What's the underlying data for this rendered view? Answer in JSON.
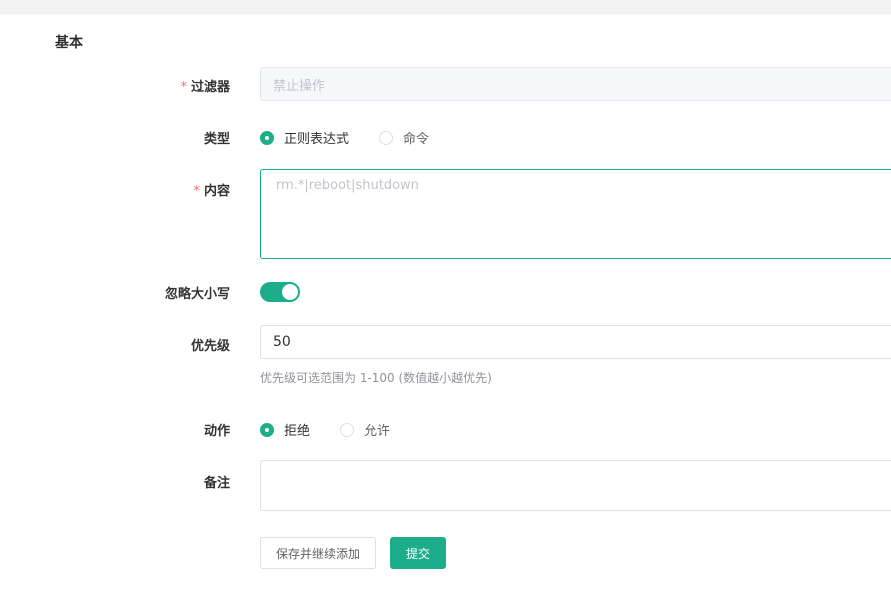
{
  "section": {
    "title": "基本"
  },
  "fields": {
    "filter": {
      "label": "过滤器",
      "required_mark": "*",
      "placeholder": "禁止操作"
    },
    "type": {
      "label": "类型",
      "options": [
        "正则表达式",
        "命令"
      ],
      "selected": "正则表达式"
    },
    "content": {
      "label": "内容",
      "required_mark": "*",
      "placeholder": "rm.*|reboot|shutdown"
    },
    "ignore_case": {
      "label": "忽略大小写",
      "enabled": true
    },
    "priority": {
      "label": "优先级",
      "value": "50",
      "hint": "优先级可选范围为 1-100 (数值越小越优先)"
    },
    "action": {
      "label": "动作",
      "options": [
        "拒绝",
        "允许"
      ],
      "selected": "拒绝"
    },
    "remark": {
      "label": "备注",
      "value": ""
    }
  },
  "buttons": {
    "save_continue": "保存并继续添加",
    "submit": "提交"
  },
  "colors": {
    "accent": "#1cae8b",
    "required": "#f56c6c"
  }
}
